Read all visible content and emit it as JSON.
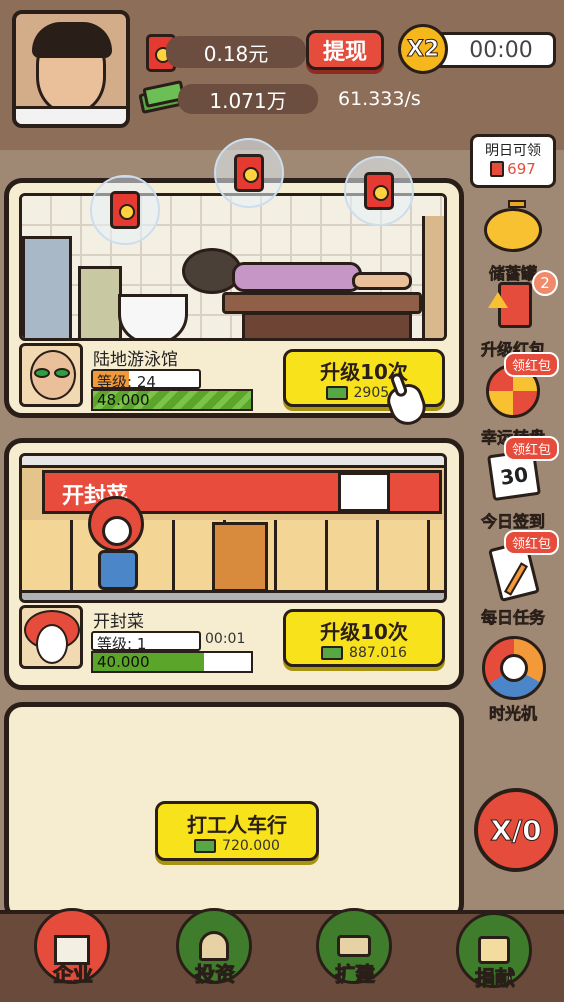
{
  "header": {
    "cash": "0.18元",
    "withdraw_label": "提现",
    "multiplier": "X2",
    "timer": "00:00",
    "coins": "1.071万",
    "rate": "61.333/s"
  },
  "side": {
    "tomorrow_title": "明日可领",
    "tomorrow_amount": "697",
    "piggy_label": "储蓄罐",
    "upgrade_label": "升级红包",
    "upgrade_badge": "2",
    "wheel_label": "幸运转盘",
    "wheel_badge": "领红包",
    "checkin_label": "今日签到",
    "checkin_badge": "领红包",
    "checkin_day": "30",
    "task_label": "每日任务",
    "task_badge": "领红包",
    "timemachine_label": "时光机",
    "x0_label": "X/0"
  },
  "businesses": [
    {
      "name": "陆地游泳馆",
      "level_label": "等级:",
      "level": "24",
      "income": "48.000",
      "progress": 1.0,
      "button": "升级10次",
      "cost": "2905.9"
    },
    {
      "name": "开封菜",
      "level_label": "等级:",
      "level": "1",
      "timer": "00:01",
      "income": "40.000",
      "progress": 0.7,
      "button": "升级10次",
      "cost": "887.016",
      "sign": "开封菜"
    }
  ],
  "locked": {
    "name": "打工人车行",
    "cost": "720.000"
  },
  "nav": [
    {
      "label": "企业",
      "icon": "factory-icon"
    },
    {
      "label": "投资",
      "icon": "mushroom-icon"
    },
    {
      "label": "扩建",
      "icon": "hammer-icon"
    },
    {
      "label": "捐献",
      "icon": "box-icon"
    }
  ],
  "colors": {
    "accent_red": "#e54c3c",
    "button_yellow": "#f8e21b",
    "progress_green": "#5aa52a",
    "panel_bg": "#f6ecd0"
  }
}
